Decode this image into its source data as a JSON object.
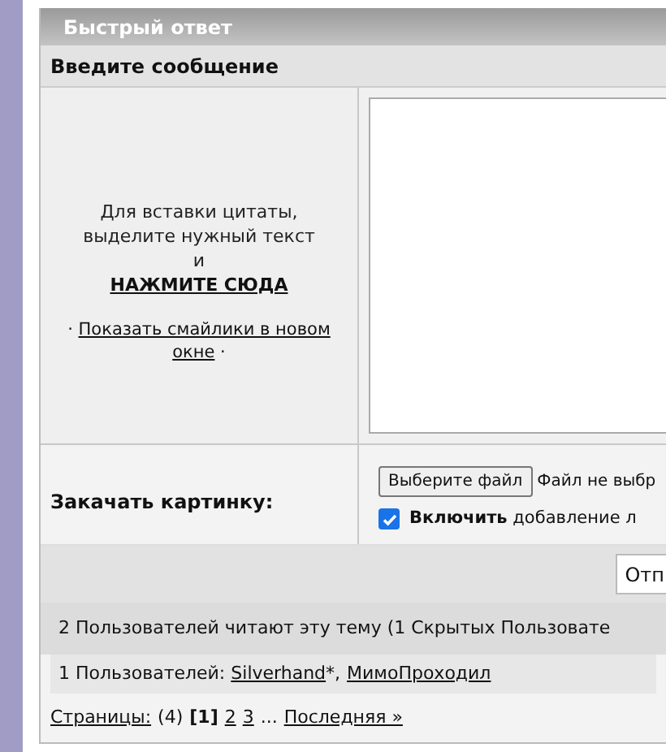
{
  "panel_title": "Быстрый ответ",
  "message_heading": "Введите сообщение",
  "quote_hint": {
    "text": "Для вставки цитаты, выделите нужный текст и",
    "link": "НАЖМИТЕ СЮДА"
  },
  "smilies": {
    "bullet_before": "·",
    "link": "Показать смайлики в новом окне",
    "bullet_after": "·"
  },
  "upload": {
    "label": "Закачать картинку:",
    "button": "Выберите файл",
    "status": "Файл не выбр"
  },
  "include_option": {
    "checked": true,
    "bold": "Включить",
    "text": "добавление л"
  },
  "submit_button": "Отп",
  "readers": "2 Пользователей читают эту тему (1 Скрытых Пользовате",
  "users": {
    "label": "1 Пользователей:",
    "names": [
      {
        "name": "Silverhand",
        "suffix": "*,"
      },
      {
        "name": "МимоПроходил"
      }
    ]
  },
  "pagination": {
    "label": "Страницы:",
    "count": "(4)",
    "current_open": "[",
    "current_close": "]",
    "pages": [
      {
        "label": "1",
        "selected": true
      },
      {
        "label": "2",
        "selected": false
      },
      {
        "label": "3",
        "selected": false
      }
    ],
    "ellipsis": "...",
    "last": "Последняя »"
  }
}
